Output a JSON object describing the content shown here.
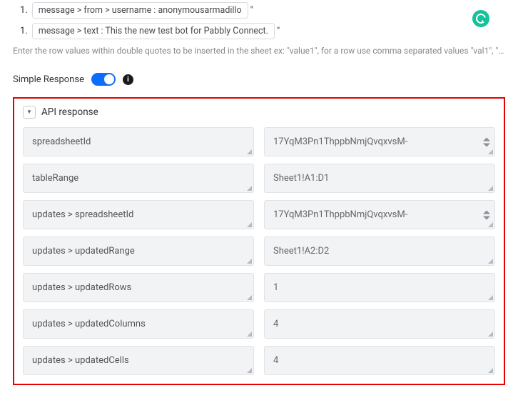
{
  "top": {
    "items": [
      {
        "num": "1.",
        "path": "message > from > username :",
        "value": "anonymousarmadillo"
      },
      {
        "num": "1.",
        "path": "message > text :",
        "value": "This the new test bot for Pabbly Connect."
      }
    ],
    "helper": "Enter the row values within double quotes to be inserted in the sheet ex: \"value1\", for a row use comma separated values \"val1\", \"val2\", ..."
  },
  "simple": {
    "label": "Simple Response"
  },
  "api": {
    "title": "API response",
    "rows": [
      {
        "key": "spreadsheetId",
        "value": "17YqM3Pn1ThppbNmjQvqxvsM-",
        "stepper": true
      },
      {
        "key": "tableRange",
        "value": "Sheet1!A1:D1"
      },
      {
        "key": "updates > spreadsheetId",
        "value": "17YqM3Pn1ThppbNmjQvqxvsM-",
        "stepper": true
      },
      {
        "key": "updates > updatedRange",
        "value": "Sheet1!A2:D2"
      },
      {
        "key": "updates > updatedRows",
        "value": "1"
      },
      {
        "key": "updates > updatedColumns",
        "value": "4"
      },
      {
        "key": "updates > updatedCells",
        "value": "4"
      }
    ]
  }
}
